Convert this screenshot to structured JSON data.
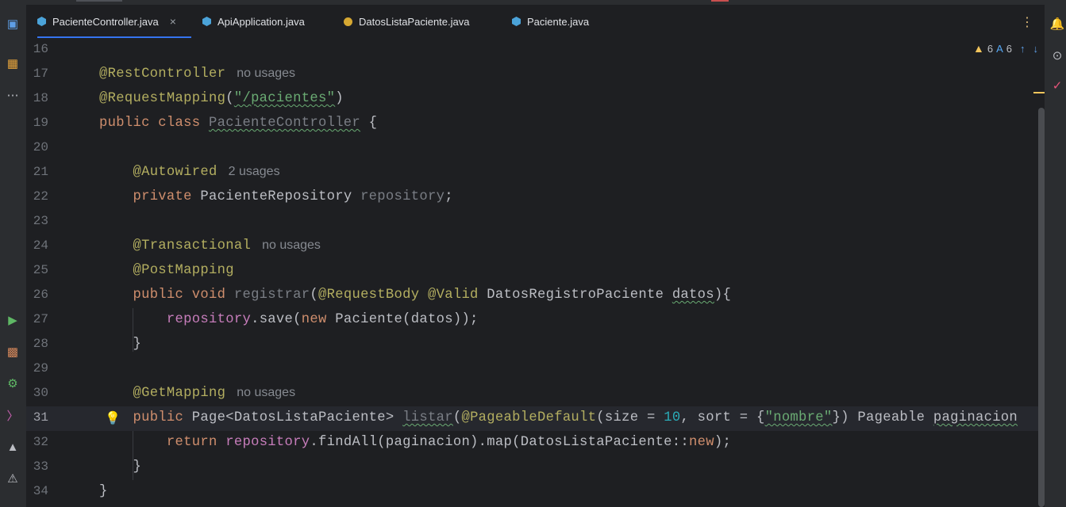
{
  "tabs": [
    {
      "label": "PacienteController.java",
      "icon": "class-icon",
      "active": true,
      "closable": true
    },
    {
      "label": "ApiApplication.java",
      "icon": "app-class-icon",
      "active": false
    },
    {
      "label": "DatosListaPaciente.java",
      "icon": "record-icon",
      "active": false
    },
    {
      "label": "Paciente.java",
      "icon": "class-icon",
      "active": false
    }
  ],
  "inspections": {
    "warnings": "6",
    "typos": "6"
  },
  "lines": [
    {
      "n": "16"
    },
    {
      "n": "17"
    },
    {
      "n": "18"
    },
    {
      "n": "19"
    },
    {
      "n": "20"
    },
    {
      "n": "21"
    },
    {
      "n": "22"
    },
    {
      "n": "23"
    },
    {
      "n": "24"
    },
    {
      "n": "25"
    },
    {
      "n": "26"
    },
    {
      "n": "27"
    },
    {
      "n": "28"
    },
    {
      "n": "29"
    },
    {
      "n": "30"
    },
    {
      "n": "31"
    },
    {
      "n": "32"
    },
    {
      "n": "33"
    },
    {
      "n": "34"
    }
  ],
  "code": {
    "l17_ann": "@RestController",
    "l17_hint": "no usages",
    "l18_ann": "@RequestMapping",
    "l18_open": "(",
    "l18_str": "\"/pacientes\"",
    "l18_close": ")",
    "l19_kw": "public class ",
    "l19_name": "PacienteController",
    "l19_rest": " {",
    "l21_ann": "@Autowired",
    "l21_hint": "2 usages",
    "l22_kw": "private ",
    "l22_type": "PacienteRepository ",
    "l22_field": "repository",
    "l22_semi": ";",
    "l24_ann": "@Transactional",
    "l24_hint": "no usages",
    "l25_ann": "@PostMapping",
    "l26_kw": "public void ",
    "l26_fn": "registrar",
    "l26_p1": "(",
    "l26_ann1": "@RequestBody ",
    "l26_ann2": "@Valid ",
    "l26_type": "DatosRegistroPaciente ",
    "l26_param": "datos",
    "l26_end": "){",
    "l27_field": "repository",
    "l27_mid": ".save(",
    "l27_kw": "new ",
    "l27_rest": "Paciente(datos));",
    "l28": "}",
    "l30_ann": "@GetMapping",
    "l30_hint": "no usages",
    "l31_kw": "public ",
    "l31_type": "Page<DatosListaPaciente> ",
    "l31_fn": "listar",
    "l31_p1": "(",
    "l31_ann": "@PageableDefault",
    "l31_p2": "(size = ",
    "l31_num": "10",
    "l31_p3": ", sort = {",
    "l31_str": "\"nombre\"",
    "l31_p4": "}) Pageable ",
    "l31_param": "paginacion",
    "l32_kw": "return ",
    "l32_field": "repository",
    "l32_mid": ".findAll(paginacion).map(DatosListaPaciente::",
    "l32_new": "new",
    "l32_end": ");",
    "l33": "}",
    "l34": "}"
  },
  "colors": {
    "accent": "#3574f0",
    "keyword": "#cf8e6d",
    "annotation": "#b3ae60",
    "string": "#6aab73",
    "number": "#2aacb8",
    "field": "#c77dbb"
  }
}
